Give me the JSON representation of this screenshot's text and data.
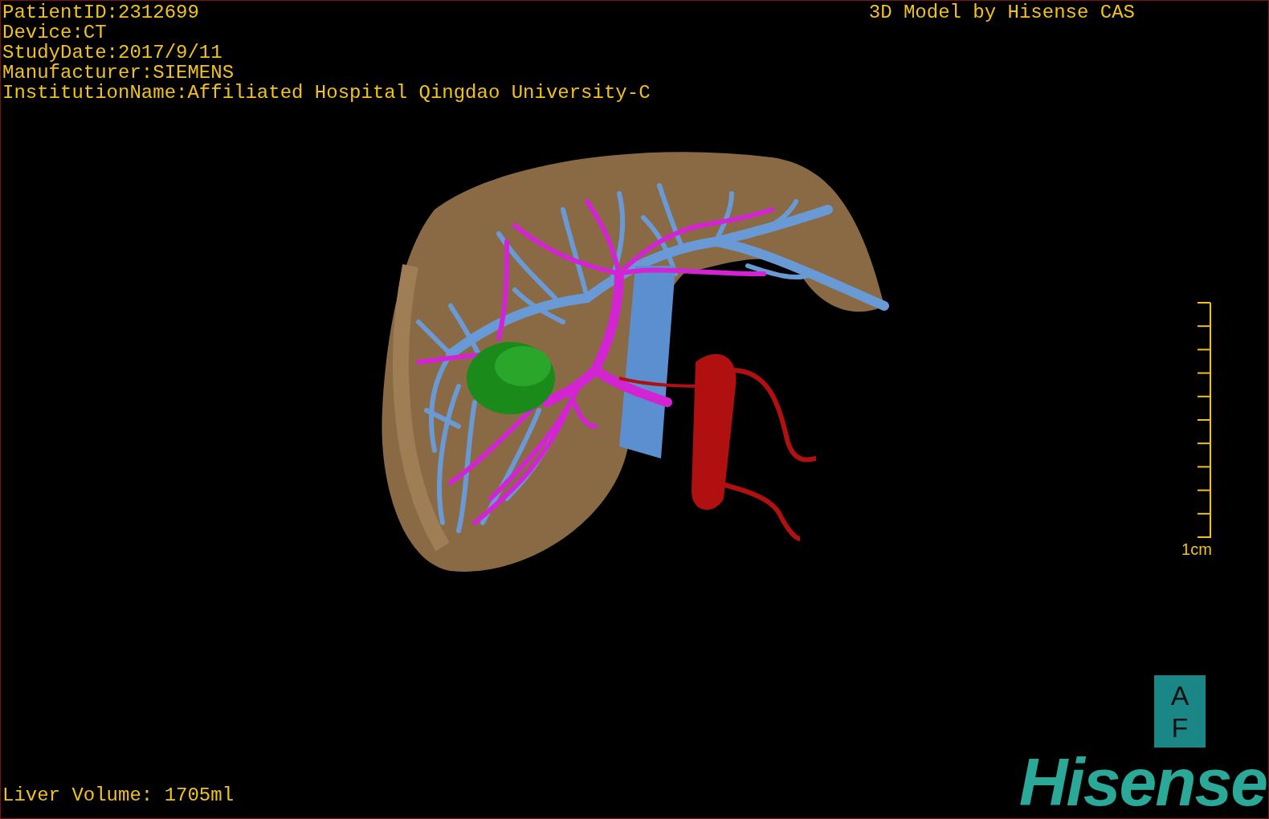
{
  "info_lines": [
    "PatientID:2312699",
    "Device:CT",
    "StudyDate:2017/9/11",
    "Manufacturer:SIEMENS",
    "InstitutionName:Affiliated Hospital Qingdao University-C"
  ],
  "title": "3D Model by Hisense CAS",
  "scale_label": "1cm",
  "liver_volume": "Liver Volume: 1705ml",
  "logo": {
    "badge_letters": [
      "A",
      "F"
    ],
    "brand": "Hisense"
  }
}
